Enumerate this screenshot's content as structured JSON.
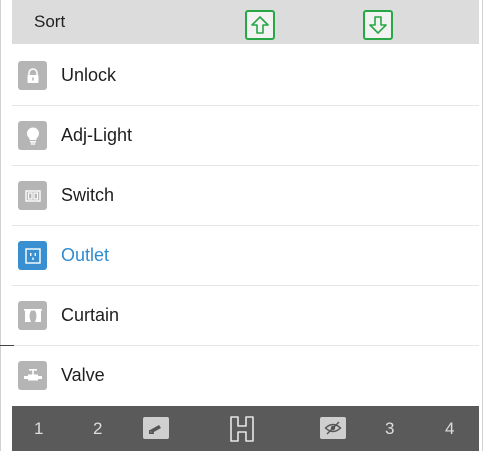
{
  "header": {
    "title": "Sort",
    "move_up_icon": "arrow-up-icon",
    "move_down_icon": "arrow-down-icon",
    "accent_color": "#28a745"
  },
  "devices": [
    {
      "label": "Unlock",
      "icon": "lock-icon",
      "selected": false
    },
    {
      "label": "Adj-Light",
      "icon": "bulb-icon",
      "selected": false
    },
    {
      "label": "Switch",
      "icon": "switch-icon",
      "selected": false
    },
    {
      "label": "Outlet",
      "icon": "outlet-icon",
      "selected": true
    },
    {
      "label": "Curtain",
      "icon": "curtain-icon",
      "selected": false
    },
    {
      "label": "Valve",
      "icon": "valve-icon",
      "selected": false
    }
  ],
  "selected_color": "#2f8ccf",
  "bottom_bar": {
    "tab1": "1",
    "tab2": "2",
    "tab3": "3",
    "tab4": "4",
    "icons": [
      "camera-icon",
      "h-icon",
      "eye-off-icon"
    ]
  }
}
